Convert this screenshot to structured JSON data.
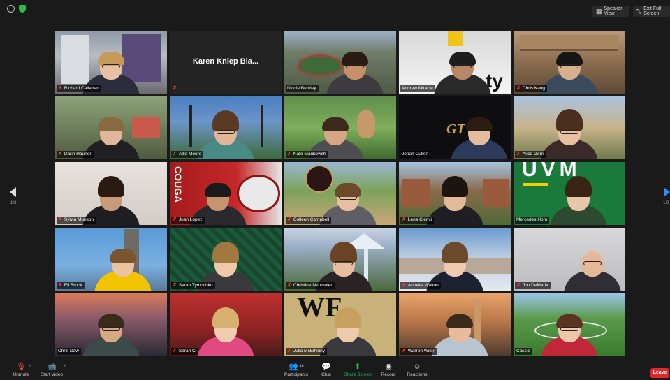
{
  "topbar": {
    "speaker_view": "Speaker View",
    "exit_full_screen": "Exit Full Screen"
  },
  "page_indicator": {
    "left": "1/2",
    "right": "1/2"
  },
  "participants": [
    {
      "name": "Richard Callahan",
      "muted": true
    },
    {
      "name": "Karen Kniep Bla...",
      "muted": true,
      "video_off": true
    },
    {
      "name": "Nicole Bentley",
      "muted": false
    },
    {
      "name": "Andrew Miracle",
      "muted": false,
      "active": true
    },
    {
      "name": "Chris Kang",
      "muted": true
    },
    {
      "name": "Darin Hauner",
      "muted": true
    },
    {
      "name": "Allie Moore",
      "muted": true
    },
    {
      "name": "Nate Mankovich",
      "muted": true
    },
    {
      "name": "Jonah Cullen",
      "muted": false
    },
    {
      "name": "Alice Gem",
      "muted": true
    },
    {
      "name": "Sylvia Munson",
      "muted": true
    },
    {
      "name": "Juan Lopez",
      "muted": true
    },
    {
      "name": "Colleen Campbell",
      "muted": true
    },
    {
      "name": "Lena Clerici",
      "muted": true
    },
    {
      "name": "Mercedes Horn",
      "muted": false
    },
    {
      "name": "Eli Brock",
      "muted": true
    },
    {
      "name": "Sarah Tymochko",
      "muted": true
    },
    {
      "name": "Christine Neumaier",
      "muted": true
    },
    {
      "name": "Anneka Walton",
      "muted": true
    },
    {
      "name": "Jon DeMaria",
      "muted": true
    },
    {
      "name": "Chris Daw",
      "muted": true
    },
    {
      "name": "Sarah C",
      "muted": true
    },
    {
      "name": "Julia McElhinny",
      "muted": true
    },
    {
      "name": "Warren Wiler",
      "muted": true
    },
    {
      "name": "Cassie",
      "muted": true
    }
  ],
  "backdrop_text": {
    "couga": "COUGA",
    "uvm": "UVM",
    "gt": "GT",
    "wf": "WF",
    "ty": "ty"
  },
  "toolbar": {
    "unmute": "Unmute",
    "start_video": "Start Video",
    "participants": "Participants",
    "participant_count": "38",
    "chat": "Chat",
    "share_screen": "Share Screen",
    "record": "Record",
    "reactions": "Reactions",
    "leave": "Leave"
  },
  "colors": {
    "accent_green": "#19c35a",
    "leave_red": "#e02828",
    "active_speaker": "#ffe32b",
    "next_arrow": "#2d8cff"
  }
}
